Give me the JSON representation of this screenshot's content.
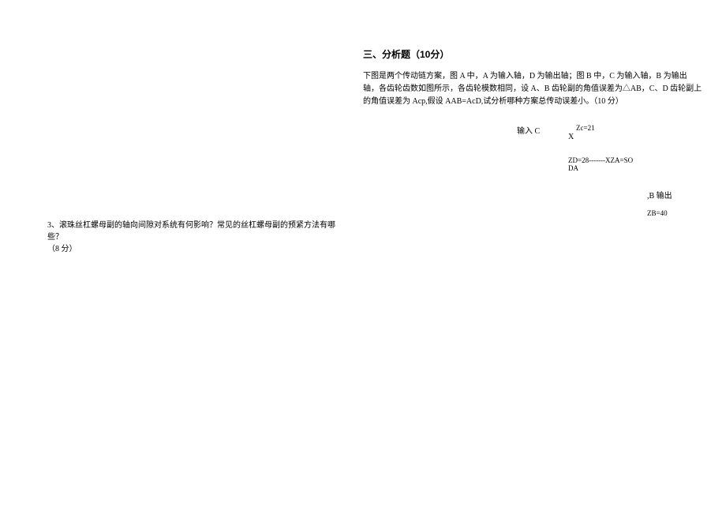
{
  "left": {
    "q3_line1": "3、滚珠丝杠螺母副的轴向间隙对系统有何影响？常见的丝杠螺母副的预紧方法有哪些？",
    "q3_line2": "（8 分）"
  },
  "right": {
    "section_heading": "三、分析题（10分）",
    "problem": "下图是两个传动链方案，图 A 中，A 为输入轴，D 为输出轴；图 B 中，C 为输入轴，B 为输出轴，各齿轮齿数如图所示，各齿轮模数相同，设 A、B 齿轮副的角值误差为△AB，C、D 齿轮副上的角值误差为 Acp,假设 AAB=AcD,试分析哪种方案总传动误差小。（10 分）",
    "diagram": {
      "input_c": "输入 C",
      "zc": "Zc=21",
      "x": "X",
      "zd_line": "ZD=28-------XZA=SO",
      "da": "DA",
      "b_output": ",B 输出",
      "zb": "ZB=40"
    }
  }
}
